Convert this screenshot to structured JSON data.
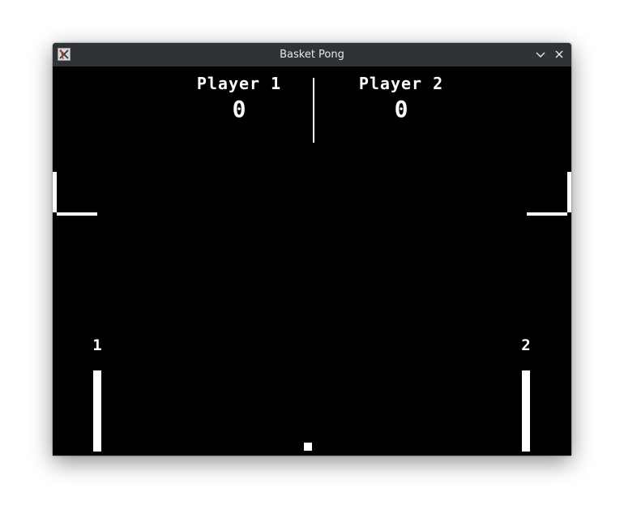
{
  "window": {
    "title": "Basket Pong",
    "app_icon": "x-window-icon",
    "controls": {
      "minimize_icon": "chevron-down-icon",
      "close_icon": "close-icon"
    }
  },
  "scoreboard": {
    "player1": {
      "label": "Player 1",
      "score": "0"
    },
    "player2": {
      "label": "Player 2",
      "score": "0"
    }
  },
  "paddles": {
    "left_label": "1",
    "right_label": "2"
  },
  "colors": {
    "background": "#000000",
    "foreground": "#ffffff",
    "titlebar": "#2f3237"
  }
}
